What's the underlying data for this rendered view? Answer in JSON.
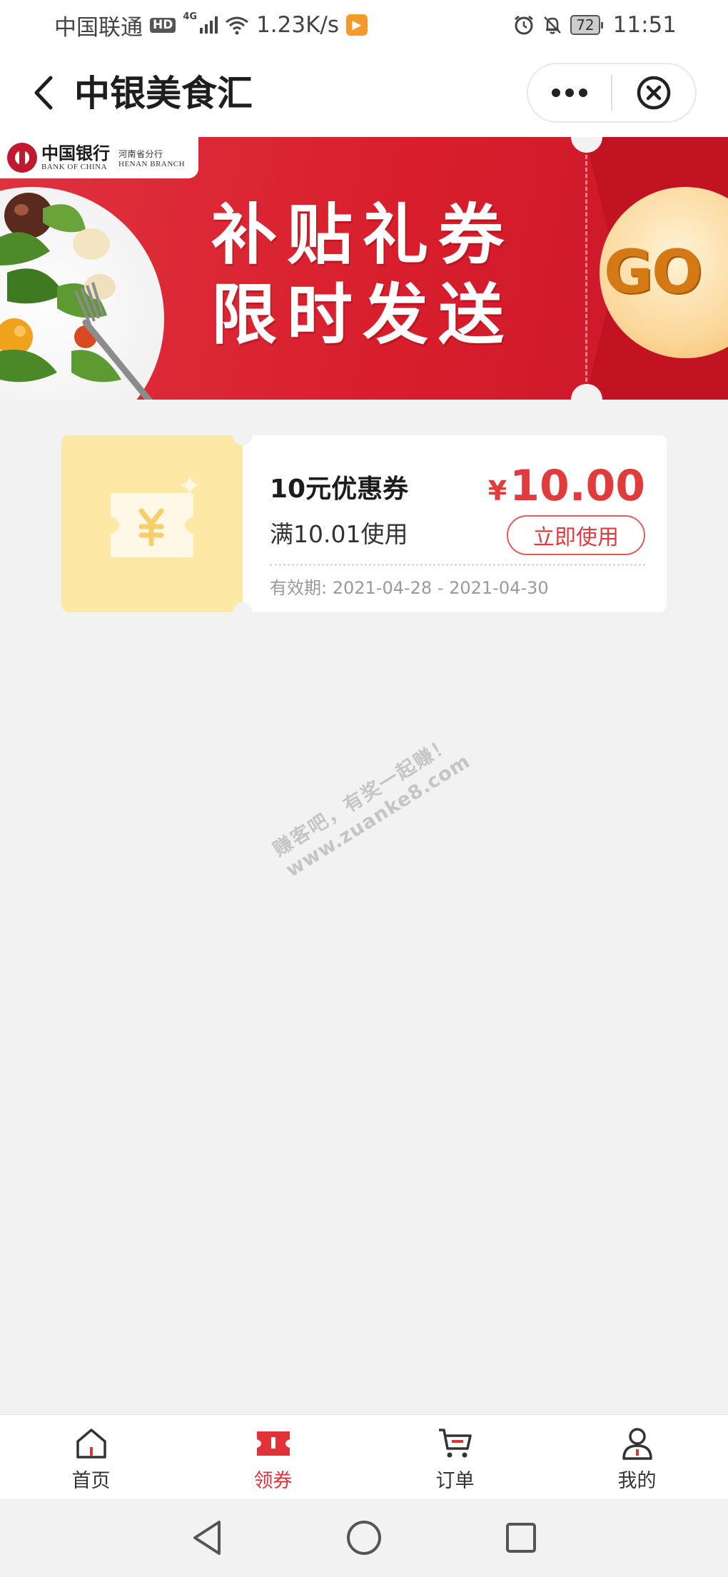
{
  "status_bar": {
    "carrier": "中国联通",
    "hd": "HD",
    "network": "4G",
    "speed": "1.23K/s",
    "app_badge": "▶",
    "battery": "72",
    "time": "11:51"
  },
  "nav": {
    "title": "中银美食汇",
    "back_icon": "chevron-left-icon",
    "more_icon": "more-dots-icon",
    "close_icon": "close-circle-icon"
  },
  "banner": {
    "bank_name_cn": "中国银行",
    "bank_name_en": "BANK OF CHINA",
    "branch_cn": "河南省分行",
    "branch_en": "HENAN BRANCH",
    "slogan_line1": "补贴礼券",
    "slogan_line2": "限时发送",
    "go_label": "GO",
    "colors": {
      "primary": "#d81e2c",
      "stub": "#c21323",
      "go": "#d37a16"
    }
  },
  "coupon": {
    "title": "10元优惠券",
    "condition": "满10.01使用",
    "currency_symbol": "¥",
    "amount": "10.00",
    "use_button": "立即使用",
    "validity": "有效期: 2021-04-28 - 2021-04-30",
    "icon": "yen-ticket-icon",
    "colors": {
      "accent": "#e23b3e",
      "left_bg": "#fde8a5"
    }
  },
  "watermark": {
    "line1": "赚客吧，有奖一起赚！",
    "line2": "www.zuanke8.com"
  },
  "tab_bar": {
    "tabs": [
      {
        "label": "首页",
        "icon": "home-icon",
        "active": false
      },
      {
        "label": "领券",
        "icon": "ticket-icon",
        "active": true
      },
      {
        "label": "订单",
        "icon": "cart-icon",
        "active": false
      },
      {
        "label": "我的",
        "icon": "user-icon",
        "active": false
      }
    ],
    "active_color": "#e03238"
  },
  "system_nav": {
    "buttons": [
      "back-triangle-icon",
      "home-circle-icon",
      "recent-square-icon"
    ]
  }
}
